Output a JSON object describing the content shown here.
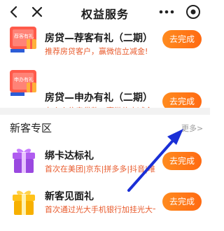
{
  "nav": {
    "title": "权益服务",
    "icons": [
      "back-icon",
      "close-icon",
      "more-icon",
      "target-icon"
    ]
  },
  "loan_items": [
    {
      "title": "房贷—荐客有礼（二期）",
      "subtitle": "推荐房贷客户，赢微信立减金!",
      "button": "去完成",
      "thumb_text": "荐客有礼"
    },
    {
      "title": "房贷—申办有礼（二期）",
      "subtitle": "办个人住房贷款，赢微信立减金!",
      "button": "去完成",
      "thumb_text": "申办有礼"
    }
  ],
  "new_customer": {
    "section_title": "新客专区",
    "more_label": "更多>",
    "items": [
      {
        "title": "绑卡达标礼",
        "subtitle": "首次在美团|京东|拼多多|抖音|唯...",
        "button": "去完成"
      },
      {
        "title": "新客见面礼",
        "subtitle": "首次通过光大手机银行加挂光大卡...",
        "button": "去完成"
      }
    ]
  },
  "colors": {
    "accent_orange": "#ff7a1a",
    "subtitle_orange": "#e85a2c",
    "arrow_blue": "#1a2fd6"
  }
}
